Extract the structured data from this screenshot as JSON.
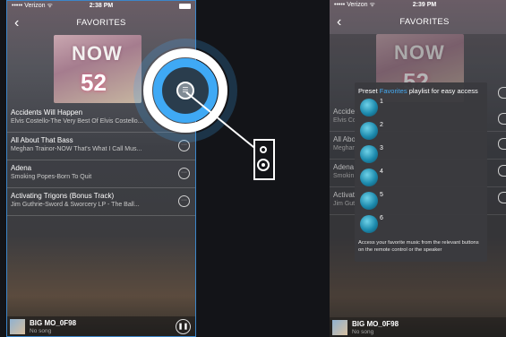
{
  "left": {
    "status": {
      "carrier": "••••• Verizon ᯤ",
      "time": "2:38 PM",
      "icons": "↗ ✱"
    },
    "nav": {
      "title": "FAVORITES",
      "back": "‹"
    },
    "album": {
      "brand": "NOW",
      "number": "52"
    },
    "tracks": [
      {
        "name": "Accidents Will Happen",
        "sub": "Elvis Costello-The Very Best Of Elvis Costello..."
      },
      {
        "name": "All About That Bass",
        "sub": "Meghan Trainor-NOW That's What I Call Mus..."
      },
      {
        "name": "Adena",
        "sub": "Smoking Popes-Born To Quit"
      },
      {
        "name": "Activating Trigons (Bonus Track)",
        "sub": "Jim Guthrie-Sword & Sworcery LP - The Ball..."
      }
    ],
    "player": {
      "name": "BIG MO_0F98",
      "sub": "No song"
    }
  },
  "right": {
    "status": {
      "carrier": "••••• Verizon ᯤ",
      "time": "2:39 PM",
      "icons": "↗ ✱"
    },
    "nav": {
      "title": "FAVORITES",
      "back": "‹"
    },
    "album": {
      "brand": "NOW",
      "number": "52"
    },
    "tracks_partial": [
      {
        "name": "Acciden",
        "sub": "Elvis Co"
      },
      {
        "name": "All Abo",
        "sub": "Meghan"
      },
      {
        "name": "Adena",
        "sub": "Smokin"
      },
      {
        "name": "Activati",
        "sub": "Jim Gut"
      }
    ],
    "popup": {
      "head_pre": "Preset ",
      "head_hl": "Favorites",
      "head_post": " playlist for easy access",
      "presets": [
        "1",
        "2",
        "3",
        "4",
        "5",
        "6"
      ],
      "footer": "Access your favorite music from the relevant buttons on the remote control or the speaker"
    },
    "player": {
      "name": "BIG MO_0F98",
      "sub": "No song"
    }
  },
  "callout": {
    "ring_color": "#3fa9f5",
    "icon": "preset-icon"
  },
  "colors": {
    "highlight": "#3c86c9",
    "accent": "#45aaf2"
  }
}
